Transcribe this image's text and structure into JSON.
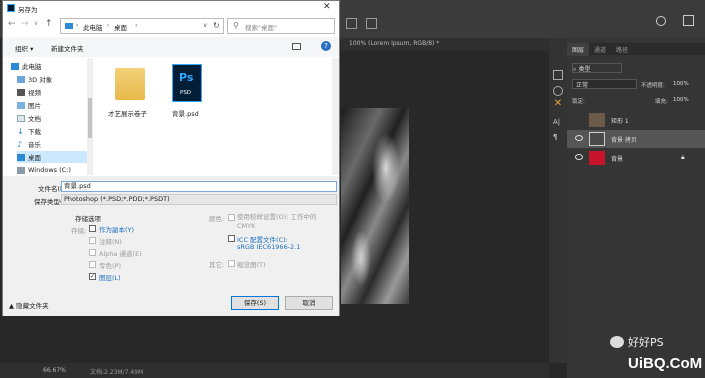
{
  "dialog": {
    "title": "另存为",
    "breadcrumb": [
      "此电脑",
      "桌面"
    ],
    "search_placeholder": "搜索\"桌面\"",
    "toolbar": {
      "organize": "组织 ▾",
      "new_folder": "新建文件夹"
    },
    "nav_items": [
      "此电脑",
      "3D 对象",
      "视频",
      "图片",
      "文档",
      "下载",
      "音乐",
      "桌面",
      "Windows (C:)"
    ],
    "files": [
      {
        "name": "才艺展示卷子",
        "type": "folder"
      },
      {
        "name": "背景.psd",
        "type": "psd",
        "icon_text": "Ps",
        "icon_sub": "PSD"
      }
    ],
    "filename_label": "文件名(N):",
    "filename_value": "背景.psd",
    "filetype_label": "保存类型(T):",
    "filetype_value": "Photoshop (*.PSD;*.PDD;*.PSDT)",
    "save_options_title": "存储选项",
    "save_label": "存储:",
    "options": {
      "as_copy": "作为副本(Y)",
      "notes": "注释(N)",
      "alpha": "Alpha 通道(E)",
      "spot": "专色(P)",
      "layers": "图层(L)"
    },
    "color_label": "颜色:",
    "proof_label": "使用校样设置(O): 工作中的 CMYK",
    "icc_label": "ICC 配置文件(C):",
    "icc_value": "sRGB IEC61966-2.1",
    "other_label": "其它:",
    "thumbnail_label": "缩览图(T)",
    "hide_folders": "隐藏文件夹",
    "save_button": "保存(S)",
    "cancel_button": "取消"
  },
  "photoshop": {
    "doc_tab": "100% (Lorem Ipsum, RGB/8) *",
    "zoom": "66.67%",
    "doc_info": "文档:2.23M/7.49M",
    "panel_tabs": [
      "图层",
      "通道",
      "路径"
    ],
    "filter_kind": "类型",
    "blend_mode": "正常",
    "opacity_label": "不透明度:",
    "opacity_value": "100%",
    "lock_label": "锁定:",
    "fill_label": "填充:",
    "fill_value": "100%",
    "layers": [
      {
        "name": "矩形 1",
        "visible": false,
        "thumb_color": "#6b5a4a"
      },
      {
        "name": "背景 拷贝",
        "visible": true,
        "thumb_color": "#4a4a4a"
      },
      {
        "name": "背景",
        "visible": true,
        "thumb_color": "#c8142a"
      }
    ]
  },
  "watermark": {
    "wechat": "好好PS",
    "site": "UiBQ.CoM"
  },
  "colors": {
    "accent": "#0078d7",
    "link_blue": "#1a6fc0",
    "ps_blue": "#31a8ff",
    "ps_dark": "#001e36",
    "folder": "#e8b84a"
  }
}
